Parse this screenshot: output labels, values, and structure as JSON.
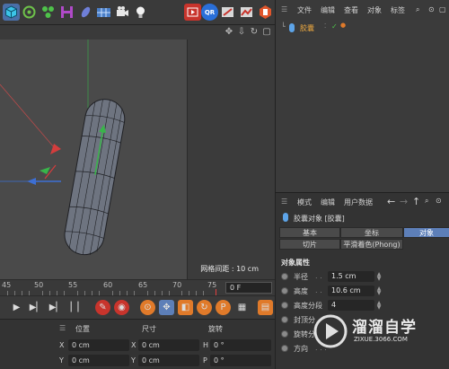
{
  "colors": {
    "accent": "#5d7fb8",
    "object_mesh": "#7a7f8a",
    "axis_x": "#d43d3d",
    "axis_y": "#39b54a",
    "axis_z": "#3d6fd4"
  },
  "toolbar": {
    "icons": [
      "cube-icon",
      "generator-icon",
      "hair-icon",
      "deformer-icon",
      "spline-icon",
      "scene-icon",
      "camera-icon",
      "light-icon",
      "render-view-icon",
      "qr-icon",
      "render-settings-icon",
      "picture-viewer-icon",
      "bodypaint-icon"
    ]
  },
  "viewport": {
    "grid_spacing": "网格间距 : 10 cm"
  },
  "timeline": {
    "ticks": [
      "45",
      "50",
      "55",
      "60",
      "65",
      "70",
      "75"
    ],
    "current_frame": "0 F"
  },
  "coordinates": {
    "headers": {
      "position": "位置",
      "size": "尺寸",
      "rotation": "旋转"
    },
    "rows": [
      {
        "axis": "X",
        "position": "0 cm",
        "size_axis": "X",
        "size": "0 cm",
        "rot_axis": "H",
        "rotation": "0 °"
      },
      {
        "axis": "Y",
        "position": "0 cm",
        "size_axis": "Y",
        "size": "0 cm",
        "rot_axis": "P",
        "rotation": "0 °"
      }
    ]
  },
  "object_manager": {
    "menu": [
      "文件",
      "编辑",
      "查看",
      "对象",
      "标签"
    ],
    "objects": [
      {
        "name": "胶囊"
      }
    ]
  },
  "attribute_manager": {
    "menu": [
      "模式",
      "编辑",
      "用户数据"
    ],
    "object_title": "胶囊对象 [胶囊]",
    "tabs_row1": [
      "基本",
      "坐标",
      "对象"
    ],
    "tabs_row2": [
      "切片",
      "平滑着色(Phong)"
    ],
    "active_tab": "对象",
    "section_title": "对象属性",
    "properties": [
      {
        "label": "半径",
        "value": "1.5 cm"
      },
      {
        "label": "高度",
        "value": "10.6 cm"
      },
      {
        "label": "高度分段",
        "value": "4"
      },
      {
        "label": "封顶分"
      },
      {
        "label": "旋转分"
      },
      {
        "label": "方向"
      }
    ]
  },
  "watermark": {
    "title": "溜溜自学",
    "url": "ZIXUE.3066.COM"
  }
}
